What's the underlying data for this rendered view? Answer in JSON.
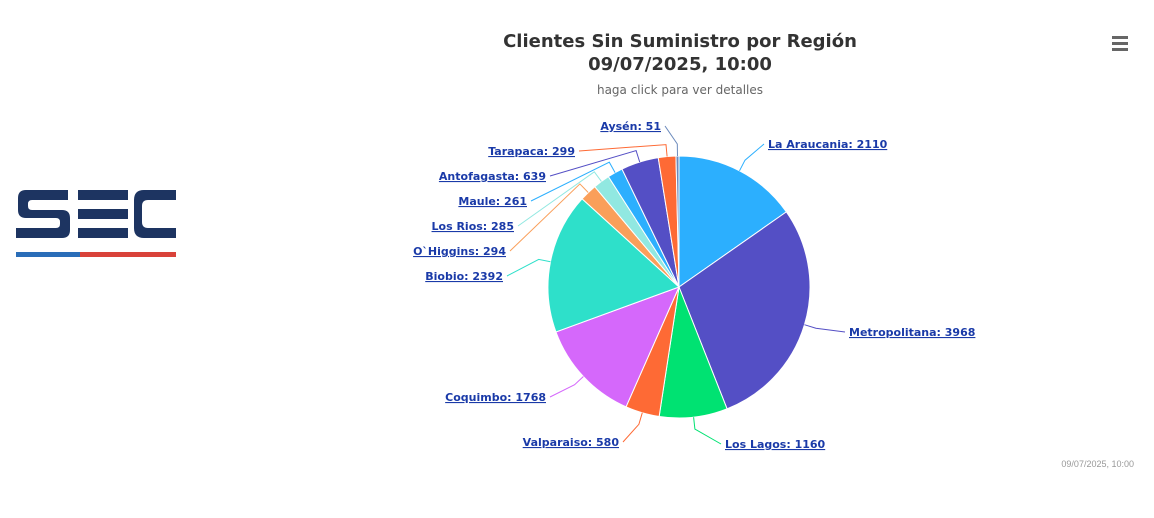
{
  "header": {
    "title_line1": "Clientes Sin Suministro por Región",
    "title_line2": "09/07/2025, 10:00",
    "subtitle": "haga click para ver detalles"
  },
  "menu": {
    "icon": "hamburger-menu-icon"
  },
  "logo": {
    "text": "SEC",
    "colors": {
      "navy": "#1d3461",
      "blue": "#2a6db8",
      "red": "#d9423a"
    }
  },
  "credit": "09/07/2025, 10:00",
  "chart_data": {
    "type": "pie",
    "title": "Clientes Sin Suministro por Región 09/07/2025, 10:00",
    "subtitle": "haga click para ver detalles",
    "slices": [
      {
        "name": "La Araucania",
        "value": 2110,
        "label": "La Araucania: 2110",
        "color": "#2caffe"
      },
      {
        "name": "Metropolitana",
        "value": 3968,
        "label": "Metropolitana: 3968",
        "color": "#544fc5"
      },
      {
        "name": "Los Lagos",
        "value": 1160,
        "label": "Los Lagos: 1160",
        "color": "#00e272"
      },
      {
        "name": "Valparaiso",
        "value": 580,
        "label": "Valparaiso: 580",
        "color": "#fe6a35"
      },
      {
        "name": "Coquimbo",
        "value": 1768,
        "label": "Coquimbo: 1768",
        "color": "#d568fb"
      },
      {
        "name": "Biobio",
        "value": 2392,
        "label": "Biobio: 2392",
        "color": "#2ee0ca"
      },
      {
        "name": "O`Higgins",
        "value": 294,
        "label": "O`Higgins: 294",
        "color": "#fa9f5a"
      },
      {
        "name": "Los Rios",
        "value": 285,
        "label": "Los Rios: 285",
        "color": "#91e8e1"
      },
      {
        "name": "Maule",
        "value": 261,
        "label": "Maule: 261",
        "color": "#2caffe"
      },
      {
        "name": "Antofagasta",
        "value": 639,
        "label": "Antofagasta: 639",
        "color": "#544fc5"
      },
      {
        "name": "Tarapaca",
        "value": 299,
        "label": "Tarapaca: 299",
        "color": "#fe6a35"
      },
      {
        "name": "Aysén",
        "value": 51,
        "label": "Aysén: 51",
        "color": "#6b8abc"
      }
    ]
  }
}
